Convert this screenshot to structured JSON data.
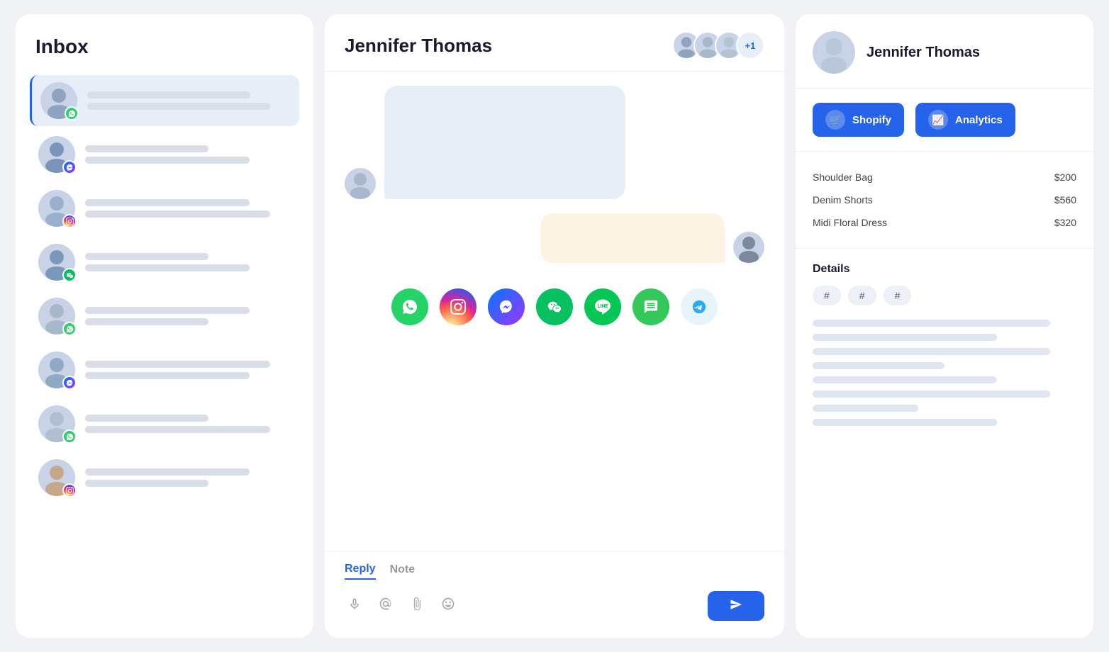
{
  "inbox": {
    "title": "Inbox",
    "items": [
      {
        "id": 1,
        "badge": "whatsapp",
        "active": true
      },
      {
        "id": 2,
        "badge": "messenger",
        "active": false
      },
      {
        "id": 3,
        "badge": "instagram",
        "active": false
      },
      {
        "id": 4,
        "badge": "wechat",
        "active": false
      },
      {
        "id": 5,
        "badge": "whatsapp",
        "active": false
      },
      {
        "id": 6,
        "badge": "messenger",
        "active": false
      },
      {
        "id": 7,
        "badge": "whatsapp",
        "active": false
      },
      {
        "id": 8,
        "badge": "instagram",
        "active": false
      }
    ]
  },
  "chat": {
    "contact_name": "Jennifer Thomas",
    "reply_tab": "Reply",
    "note_tab": "Note",
    "active_tab": "reply",
    "social_channels": [
      {
        "id": "whatsapp",
        "label": "WhatsApp"
      },
      {
        "id": "instagram",
        "label": "Instagram"
      },
      {
        "id": "messenger",
        "label": "Messenger"
      },
      {
        "id": "wechat",
        "label": "WeChat"
      },
      {
        "id": "line",
        "label": "Line"
      },
      {
        "id": "sms",
        "label": "SMS"
      },
      {
        "id": "telegram",
        "label": "Telegram"
      }
    ]
  },
  "right_panel": {
    "contact_name": "Jennifer Thomas",
    "tools": {
      "shopify_label": "Shopify",
      "analytics_label": "Analytics"
    },
    "products": [
      {
        "name": "Shoulder Bag",
        "price": "$200"
      },
      {
        "name": "Denim Shorts",
        "price": "$560"
      },
      {
        "name": "Midi Floral Dress",
        "price": "$320"
      }
    ],
    "details_title": "Details",
    "tags": [
      "#",
      "#",
      "#"
    ]
  },
  "colors": {
    "accent": "#2563eb",
    "whatsapp": "#25d366",
    "messenger_grad_start": "#0078ff",
    "messenger_grad_end": "#a033ff",
    "wechat": "#07c160",
    "telegram_bg": "#e8f4fb",
    "telegram_icon": "#2aabee"
  }
}
